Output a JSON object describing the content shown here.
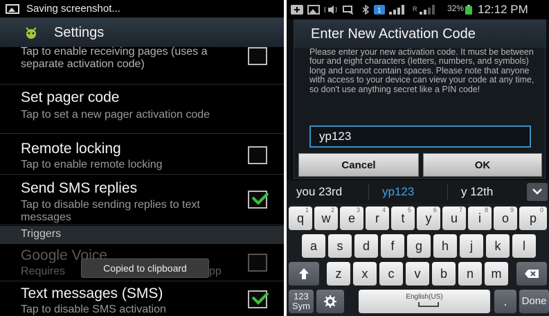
{
  "left": {
    "status_text": "Saving screenshot...",
    "app_title": "Settings",
    "rows": [
      {
        "sub": "Tap to enable receiving pages (uses a separate activation code)",
        "checked": false
      },
      {
        "title": "Set pager code",
        "sub": "Tap to set a new pager activation code"
      },
      {
        "title": "Remote locking",
        "sub": "Tap to enable remote locking",
        "checked": false
      },
      {
        "title": "Send SMS replies",
        "sub": "Tap to disable sending replies to text messages",
        "checked": true
      }
    ],
    "section_header": "Triggers",
    "google_voice": {
      "title": "Google Voice",
      "sub": "Requires",
      "sub_tail": "pp",
      "checked": false,
      "enabled": false
    },
    "toast": "Copied to clipboard",
    "sms": {
      "title": "Text messages (SMS)",
      "sub": "Tap to disable SMS activation",
      "checked": true
    }
  },
  "right": {
    "status": {
      "battery": "32%",
      "time": "12:12 PM"
    },
    "dialog": {
      "title": "Enter New Activation Code",
      "message": "Please enter your new activation code. It must be between four and eight characters (letters, numbers, and symbols) long and cannot contain spaces. Please note that anyone with access to your device can view your code at any time, so don't use anything secret like a PIN code!",
      "input_value": "yp123",
      "cancel_label": "Cancel",
      "ok_label": "OK"
    },
    "suggestions": [
      "you 23rd",
      "yp123",
      "y 12th"
    ],
    "keyboard": {
      "row1": [
        [
          "q",
          "1"
        ],
        [
          "w",
          "2"
        ],
        [
          "e",
          "3"
        ],
        [
          "r",
          "4"
        ],
        [
          "t",
          "5"
        ],
        [
          "y",
          "6"
        ],
        [
          "u",
          "7"
        ],
        [
          "i",
          "8"
        ],
        [
          "o",
          "9"
        ],
        [
          "p",
          "0"
        ]
      ],
      "row2": [
        "a",
        "s",
        "d",
        "f",
        "g",
        "h",
        "j",
        "k",
        "l"
      ],
      "row3": [
        "z",
        "x",
        "c",
        "v",
        "b",
        "n",
        "m"
      ],
      "sym_label": "123 Sym",
      "space_label": "English(US)",
      "period_label": ".",
      "done_label": "Done"
    },
    "colors": {
      "accent": "#3fa3e6",
      "checkmark": "#3cc03c"
    }
  }
}
